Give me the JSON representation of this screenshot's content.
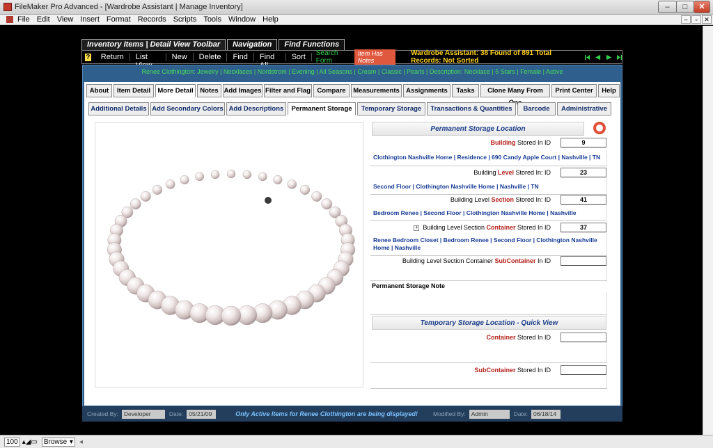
{
  "window": {
    "title": "FileMaker Pro Advanced - [Wardrobe Assistant | Manage Inventory]"
  },
  "menu": [
    "File",
    "Edit",
    "View",
    "Insert",
    "Format",
    "Records",
    "Scripts",
    "Tools",
    "Window",
    "Help"
  ],
  "toolbar_tabs": [
    "Inventory Items | Detail View Toolbar",
    "Navigation",
    "Find Functions"
  ],
  "toolbar": {
    "help": "?",
    "buttons": [
      "Return",
      "List View",
      "New",
      "Delete",
      "Find",
      "Find All",
      "Sort"
    ],
    "search_form": "Search Form",
    "item_has_notes": "Item Has Notes",
    "found_status": "Wardrobe Assistant:  38 Found of 891 Total Records: Not Sorted"
  },
  "record_line": "Renee Clothington: Jewelry | Necklaces | Nordstrom | Evening | All Seasons | Cream | Classic | Pearls | Description: Necklace | 5 Stars | Female | Active",
  "tabs1": [
    "About",
    "Item Detail",
    "More Detail",
    "Notes",
    "Add Images",
    "Filter and Flag",
    "Compare",
    "Measurements",
    "Assignments",
    "Tasks",
    "Clone Many From One",
    "Print Center",
    "Help"
  ],
  "tabs2": [
    "Additional Details",
    "Add Secondary Colors",
    "Add Descriptions",
    "Permanent Storage",
    "Temporary Storage",
    "Transactions & Quantities",
    "Barcode",
    "Administrative"
  ],
  "permanent": {
    "header": "Permanent Storage Location",
    "building": {
      "label_red": "Building",
      "label_rest": " Stored In ID",
      "id": "9",
      "info": "Clothington Nashville Home | Residence | 690 Candy Apple Court | Nashville | TN"
    },
    "level": {
      "label_pre": "Building ",
      "label_red": "Level",
      "label_rest": " Stored In: ID",
      "id": "23",
      "info": "Second Floor | Clothington Nashville Home | Nashville | TN"
    },
    "section": {
      "label_pre": "Building Level ",
      "label_red": "Section",
      "label_rest": " Stored In: ID",
      "id": "41",
      "info": "Bedroom Renee | Second Floor | Clothington Nashville Home | Nashville"
    },
    "container": {
      "label_pre": "Building Level Section ",
      "label_red": "Container",
      "label_rest": " Stored In ID",
      "id": "37",
      "info": "Renee Bedroom Closet | Bedroom Renee | Second Floor | Clothington Nashville Home | Nashville"
    },
    "subcontainer": {
      "label_pre": "Building Level Section Container ",
      "label_red": "SubContainer",
      "label_rest": " In ID",
      "id": ""
    },
    "note_label": "Permanent Storage Note"
  },
  "temporary": {
    "header": "Temporary Storage Location - Quick View",
    "container": {
      "label_red": "Container",
      "label_rest": " Stored In ID"
    },
    "subcontainer": {
      "label_red": "SubContainer",
      "label_rest": " Stored In ID"
    }
  },
  "footer": {
    "created_by_label": "Created By:",
    "created_by": "Developer",
    "date_label": "Date:",
    "created_date": "05/21/09",
    "message": "Only Active Items for Renee Clothington are being displayed!",
    "modified_by_label": "Modified By:",
    "modified_by": "Admin",
    "modified_date": "06/18/14"
  },
  "status": {
    "zoom": "100",
    "mode": "Browse"
  },
  "colors": {
    "accent_blue": "#2f5f8c",
    "found_yellow": "#ffd21c",
    "record_green": "#48e05a",
    "label_red": "#b5211a"
  }
}
